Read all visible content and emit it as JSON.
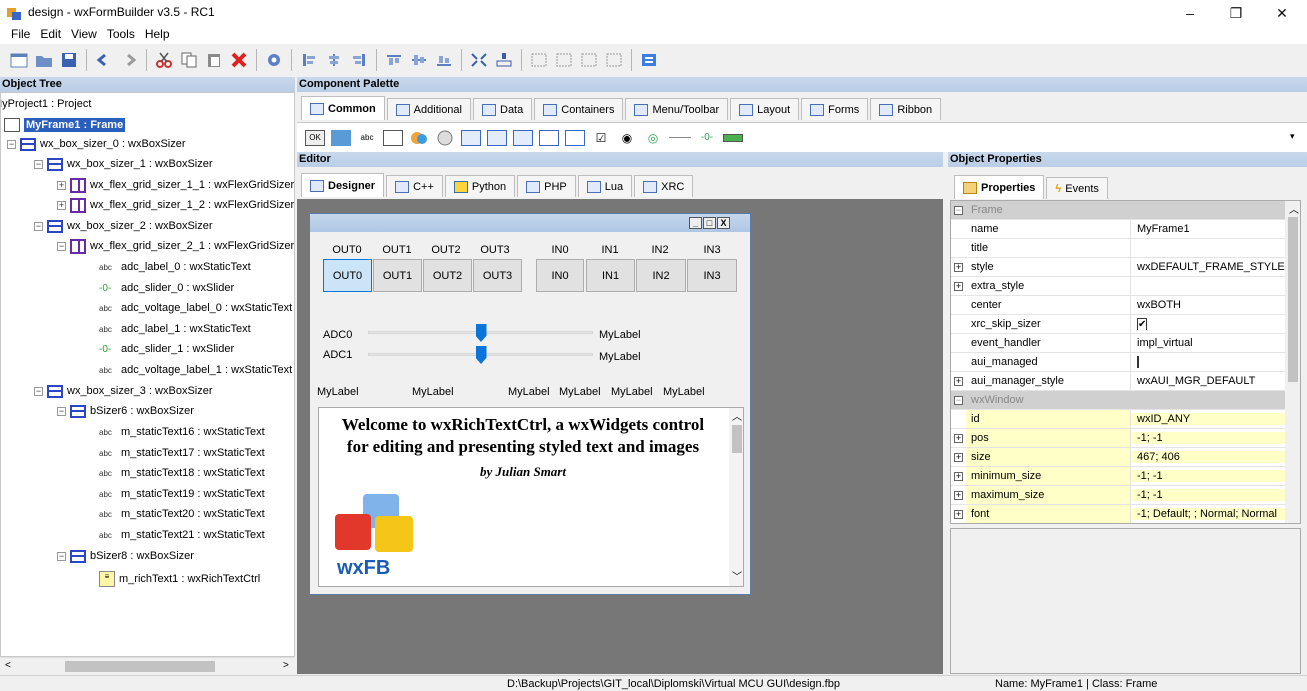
{
  "window": {
    "title": "design - wxFormBuilder v3.5 - RC1",
    "minimize": "–",
    "maximize": "❐",
    "close": "✕"
  },
  "menu": [
    "File",
    "Edit",
    "View",
    "Tools",
    "Help"
  ],
  "panels": {
    "object_tree": "Object Tree",
    "component_palette": "Component Palette",
    "editor": "Editor",
    "object_properties": "Object Properties"
  },
  "tree": [
    {
      "label": "MyProject1 : Project"
    },
    {
      "label": "MyFrame1 : Frame"
    },
    {
      "label": "wx_box_sizer_0 : wxBoxSizer"
    },
    {
      "label": "wx_box_sizer_1 : wxBoxSizer"
    },
    {
      "label": "wx_flex_grid_sizer_1_1 : wxFlexGridSizer"
    },
    {
      "label": "wx_flex_grid_sizer_1_2 : wxFlexGridSizer"
    },
    {
      "label": "wx_box_sizer_2 : wxBoxSizer"
    },
    {
      "label": "wx_flex_grid_sizer_2_1 : wxFlexGridSizer"
    },
    {
      "label": "adc_label_0 : wxStaticText"
    },
    {
      "label": "adc_slider_0 : wxSlider"
    },
    {
      "label": "adc_voltage_label_0 : wxStaticText"
    },
    {
      "label": "adc_label_1 : wxStaticText"
    },
    {
      "label": "adc_slider_1 : wxSlider"
    },
    {
      "label": "adc_voltage_label_1 : wxStaticText"
    },
    {
      "label": "wx_box_sizer_3 : wxBoxSizer"
    },
    {
      "label": "bSizer6 : wxBoxSizer"
    },
    {
      "label": "m_staticText16 : wxStaticText"
    },
    {
      "label": "m_staticText17 : wxStaticText"
    },
    {
      "label": "m_staticText18 : wxStaticText"
    },
    {
      "label": "m_staticText19 : wxStaticText"
    },
    {
      "label": "m_staticText20 : wxStaticText"
    },
    {
      "label": "m_staticText21 : wxStaticText"
    },
    {
      "label": "bSizer8 : wxBoxSizer"
    },
    {
      "label": "m_richText1 : wxRichTextCtrl"
    }
  ],
  "tree_icon_text": {
    "abc": "abc",
    "slider": "-0-"
  },
  "palette_tabs": [
    "Common",
    "Additional",
    "Data",
    "Containers",
    "Menu/Toolbar",
    "Layout",
    "Forms",
    "Ribbon"
  ],
  "palette_icon_text": {
    "ok": "OK",
    "abc": "abc"
  },
  "editor_tabs": [
    "Designer",
    "C++",
    "Python",
    "PHP",
    "Lua",
    "XRC"
  ],
  "designer": {
    "caption_buttons": [
      "_",
      "□",
      "X"
    ],
    "out_labels": [
      "OUT0",
      "OUT1",
      "OUT2",
      "OUT3",
      "IN0",
      "IN1",
      "IN2",
      "IN3"
    ],
    "out_buttons": [
      "OUT0",
      "OUT1",
      "OUT2",
      "OUT3",
      "IN0",
      "IN1",
      "IN2",
      "IN3"
    ],
    "adc": [
      {
        "label": "ADC0",
        "value": "MyLabel",
        "slider_fraction": 0.5
      },
      {
        "label": "ADC1",
        "value": "MyLabel",
        "slider_fraction": 0.5
      }
    ],
    "bottom_labels": [
      "MyLabel",
      "MyLabel",
      "MyLabel",
      "MyLabel",
      "MyLabel",
      "MyLabel"
    ],
    "rich": {
      "title_line1": "Welcome to wxRichTextCtrl, a wxWidgets control",
      "title_line2": "for editing and presenting styled text and images",
      "author": "by Julian Smart",
      "logo_text": "wxFB"
    }
  },
  "props_tabs": [
    "Properties",
    "Events"
  ],
  "properties": [
    {
      "name": "Frame",
      "value": "",
      "type": "cat"
    },
    {
      "name": "name",
      "value": "MyFrame1"
    },
    {
      "name": "title",
      "value": ""
    },
    {
      "name": "style",
      "value": "wxDEFAULT_FRAME_STYLE",
      "expand": true
    },
    {
      "name": "extra_style",
      "value": "",
      "expand": true
    },
    {
      "name": "center",
      "value": "wxBOTH"
    },
    {
      "name": "xrc_skip_sizer",
      "value": "✔",
      "check": true
    },
    {
      "name": "event_handler",
      "value": "impl_virtual"
    },
    {
      "name": "aui_managed",
      "value": "",
      "check": true
    },
    {
      "name": "aui_manager_style",
      "value": "wxAUI_MGR_DEFAULT",
      "expand": true
    },
    {
      "name": "wxWindow",
      "value": "",
      "type": "cat"
    },
    {
      "name": "id",
      "value": "wxID_ANY",
      "yellow": true
    },
    {
      "name": "pos",
      "value": "-1; -1",
      "yellow": true,
      "expand": true
    },
    {
      "name": "size",
      "value": "467; 406",
      "yellow": true,
      "expand": true
    },
    {
      "name": "minimum_size",
      "value": "-1; -1",
      "yellow": true,
      "expand": true
    },
    {
      "name": "maximum_size",
      "value": "-1; -1",
      "yellow": true,
      "expand": true
    },
    {
      "name": "font",
      "value": "-1; Default; ; Normal; Normal",
      "yellow": true,
      "expand": true
    }
  ],
  "status": {
    "path": "D:\\Backup\\Projects\\GIT_local\\Diplomski\\Virtual MCU GUI\\design.fbp",
    "info": "Name: MyFrame1 | Class: Frame"
  }
}
